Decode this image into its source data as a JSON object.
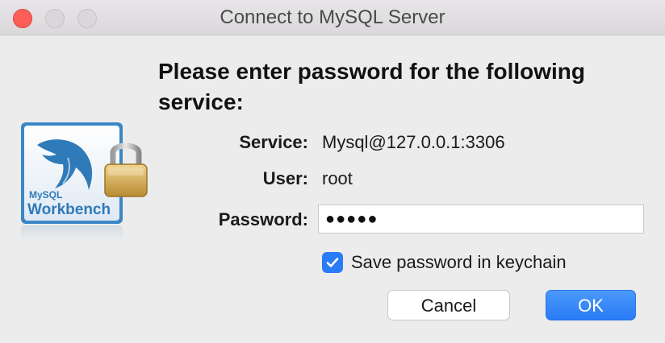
{
  "window": {
    "title": "Connect to MySQL Server"
  },
  "dialog": {
    "heading": "Please enter password for the following service:",
    "logo_text_top": "MySQL",
    "logo_text_bottom": "Workbench",
    "service_label": "Service:",
    "service_value": "Mysql@127.0.0.1:3306",
    "user_label": "User:",
    "user_value": "root",
    "password_label": "Password:",
    "password_value": "●●●●●",
    "save_checkbox_label": "Save password in keychain",
    "save_checked": true,
    "cancel_label": "Cancel",
    "ok_label": "OK"
  },
  "colors": {
    "accent": "#2a7bf6",
    "close_button": "#fd5f57"
  }
}
